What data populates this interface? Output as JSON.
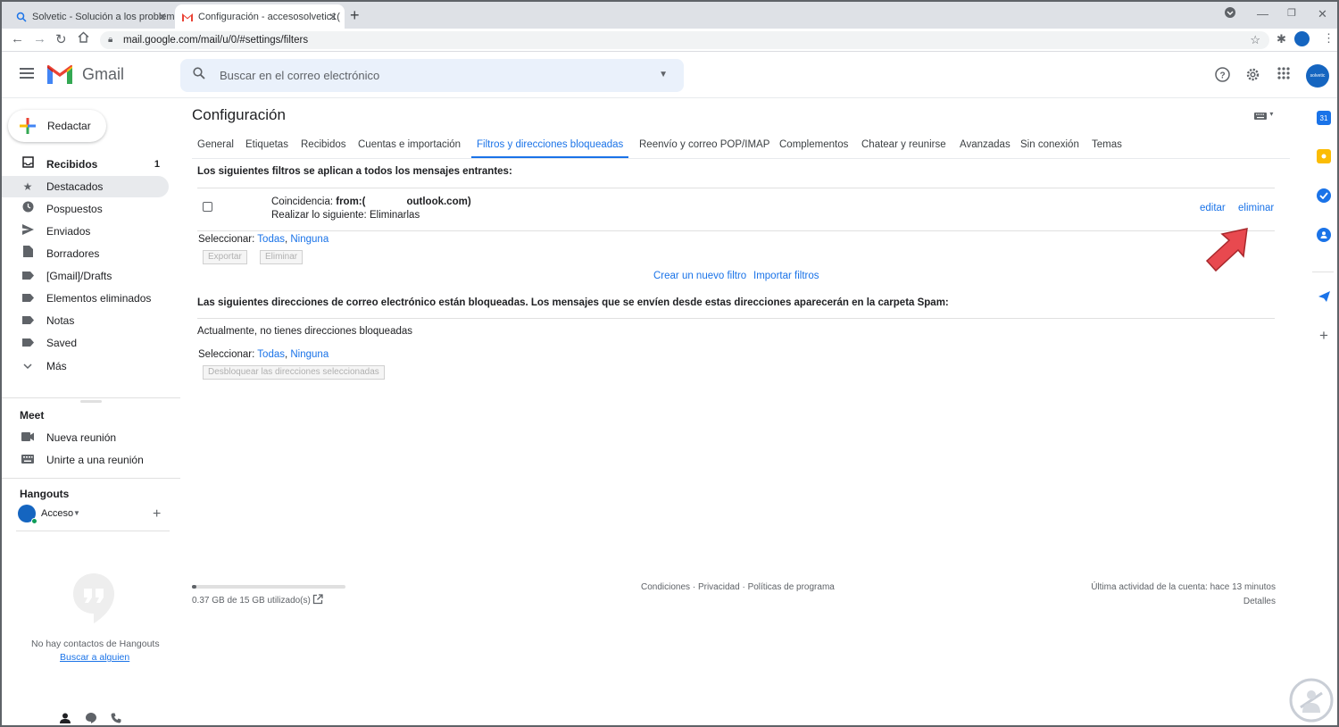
{
  "browser": {
    "tabs": [
      {
        "title": "Solvetic - Solución a los problem"
      },
      {
        "title": "Configuración - accesosolvetic1("
      }
    ],
    "url": "mail.google.com/mail/u/0/#settings/filters"
  },
  "header": {
    "app_name": "Gmail",
    "search_placeholder": "Buscar en el correo electrónico",
    "avatar_text": "solvetic"
  },
  "sidebar": {
    "compose_label": "Redactar",
    "items": [
      {
        "label": "Recibidos",
        "count": "1",
        "icon": "inbox-icon",
        "bold": true
      },
      {
        "label": "Destacados",
        "icon": "star-icon",
        "selected": true
      },
      {
        "label": "Pospuestos",
        "icon": "clock-icon"
      },
      {
        "label": "Enviados",
        "icon": "send-icon"
      },
      {
        "label": "Borradores",
        "icon": "draft-icon"
      },
      {
        "label": "[Gmail]/Drafts",
        "icon": "label-icon"
      },
      {
        "label": "Elementos eliminados",
        "icon": "label-icon"
      },
      {
        "label": "Notas",
        "icon": "label-icon"
      },
      {
        "label": "Saved",
        "icon": "label-icon"
      },
      {
        "label": "Más",
        "icon": "chevron-down-icon"
      }
    ],
    "meet": {
      "title": "Meet",
      "new_meeting": "Nueva reunión",
      "join_meeting": "Unirte a una reunión"
    },
    "hangouts": {
      "title": "Hangouts",
      "user": "Acceso",
      "no_contacts": "No hay contactos de Hangouts",
      "find_someone": "Buscar a alguien"
    }
  },
  "settings": {
    "title": "Configuración",
    "tabs": [
      {
        "label": "General"
      },
      {
        "label": "Etiquetas"
      },
      {
        "label": "Recibidos"
      },
      {
        "label": "Cuentas e importación"
      },
      {
        "label": "Filtros y direcciones bloqueadas",
        "active": true
      },
      {
        "label": "Reenvío y correo POP/IMAP"
      },
      {
        "label": "Complementos"
      },
      {
        "label": "Chatear y reunirse"
      },
      {
        "label": "Avanzadas"
      },
      {
        "label": "Sin conexión"
      },
      {
        "label": "Temas"
      }
    ],
    "filters": {
      "heading": "Los siguientes filtros se aplican a todos los mensajes entrantes:",
      "match_label": "Coincidencia:",
      "match_prefix": "from:(",
      "match_suffix": "outlook.com)",
      "action_label": "Realizar lo siguiente:",
      "action_value": "Eliminarlas",
      "edit": "editar",
      "delete": "eliminar",
      "select_label": "Seleccionar:",
      "select_all": "Todas",
      "select_none": "Ninguna",
      "export_btn": "Exportar",
      "delete_btn": "Eliminar",
      "create_filter": "Crear un nuevo filtro",
      "import_filters": "Importar filtros"
    },
    "blocked": {
      "heading": "Las siguientes direcciones de correo electrónico están bloqueadas. Los mensajes que se envíen desde estas direcciones aparecerán en la carpeta Spam:",
      "none_text": "Actualmente, no tienes direcciones bloqueadas",
      "select_label": "Seleccionar:",
      "select_all": "Todas",
      "select_none": "Ninguna",
      "unblock_btn": "Desbloquear las direcciones seleccionadas"
    }
  },
  "footer": {
    "storage": "0.37 GB de 15 GB utilizado(s)",
    "storage_fraction": 0.025,
    "terms": "Condiciones",
    "privacy": "Privacidad",
    "policies": "Políticas de programa",
    "sep": "·",
    "last_activity": "Última actividad de la cuenta: hace 13 minutos",
    "details": "Detalles"
  },
  "colors": {
    "accent": "#1a73e8",
    "arrow": "#e8494f"
  }
}
